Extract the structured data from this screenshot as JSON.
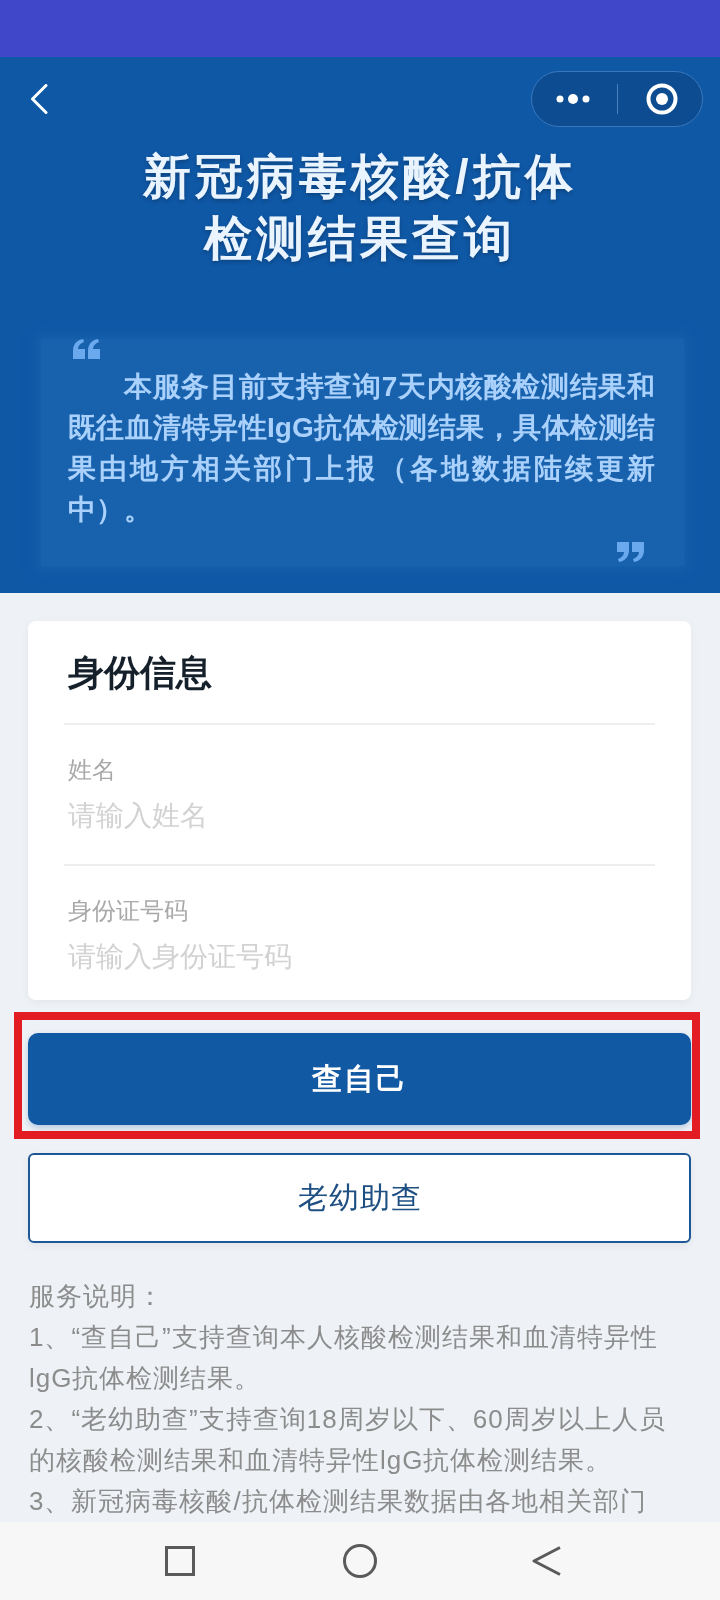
{
  "header": {
    "title_lines": [
      "新冠病毒核酸/抗体",
      "检测结果查询"
    ],
    "notice": "本服务目前支持查询7天内核酸检测结果和既往血清特异性IgG抗体检测结果，具体检测结果由地方相关部门上报（各地数据陆续更新中）。"
  },
  "identity_card": {
    "title": "身份信息",
    "fields": [
      {
        "label": "姓名",
        "placeholder": "请输入姓名"
      },
      {
        "label": "身份证号码",
        "placeholder": "请输入身份证号码"
      }
    ]
  },
  "buttons": [
    {
      "label": "查自己",
      "kind": "primary",
      "highlighted": true
    },
    {
      "label": "老幼助查",
      "kind": "outline",
      "highlighted": false
    }
  ],
  "service_notes": {
    "title": "服务说明：",
    "items": [
      "1、“查自己”支持查询本人核酸检测结果和血清特异性lgG抗体检测结果。",
      "2、“老幼助查”支持查询18周岁以下、60周岁以上人员的核酸检测结果和血清特异性lgG抗体检测结果。",
      "3、新冠病毒核酸/抗体检测结果数据由各地相关部门"
    ]
  }
}
